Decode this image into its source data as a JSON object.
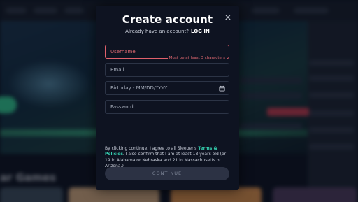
{
  "background": {
    "section_title": "ar Games"
  },
  "modal": {
    "title": "Create account",
    "subtitle_text": "Already have an account?",
    "login_link": "LOG IN",
    "close_glyph": "×",
    "fields": {
      "username": {
        "placeholder": "Username",
        "error": "Must be at least 3 characters"
      },
      "email": {
        "placeholder": "Email"
      },
      "birthday": {
        "placeholder": "Birthday - MM/DD/YYYY",
        "icon": "calendar-icon"
      },
      "password": {
        "placeholder": "Password"
      }
    },
    "terms": {
      "before": "By clicking continue, I agree to all Sleeper's ",
      "link": "Terms & Policies",
      "after": ". I also confirm that I am at least 18 years old (or 19 in Alabama or Nebraska and 21 in Massachusetts or Arizona.)"
    },
    "continue_label": "CONTINUE"
  },
  "colors": {
    "modal_bg": "#0e1321",
    "error": "#e46a73",
    "link": "#35d0b0",
    "button_bg": "#2c3244"
  }
}
